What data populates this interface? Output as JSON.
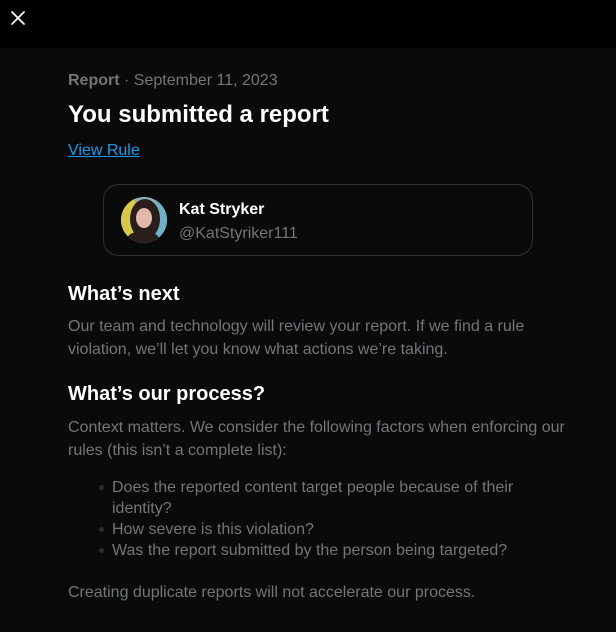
{
  "header": {
    "close_icon": "close-icon"
  },
  "report": {
    "label": "Report",
    "separator": "·",
    "date": "September 11, 2023",
    "title": "You submitted a report",
    "view_rule_link": "View Rule"
  },
  "reported_user": {
    "name": "Kat Stryker",
    "handle": "@KatStyriker111",
    "avatar_icon": "profile-photo"
  },
  "whats_next": {
    "heading": "What’s next",
    "body": "Our team and technology will review your report. If we find a rule violation, we’ll let you know what actions we’re taking."
  },
  "process": {
    "heading": "What’s our process?",
    "intro": "Context matters. We consider the following factors when enforcing our rules (this isn’t a complete list):",
    "factors": [
      "Does the reported content target people because of their identity?",
      "How severe is this violation?",
      "Was the report submitted by the person being targeted?"
    ],
    "footer_note": "Creating duplicate reports will not accelerate our process."
  },
  "colors": {
    "background": "#000000",
    "panel": "#0a0a0a",
    "primary_text": "#ffffff",
    "secondary_text": "#71767b",
    "link": "#1d9bf0",
    "border": "#2f3336"
  }
}
